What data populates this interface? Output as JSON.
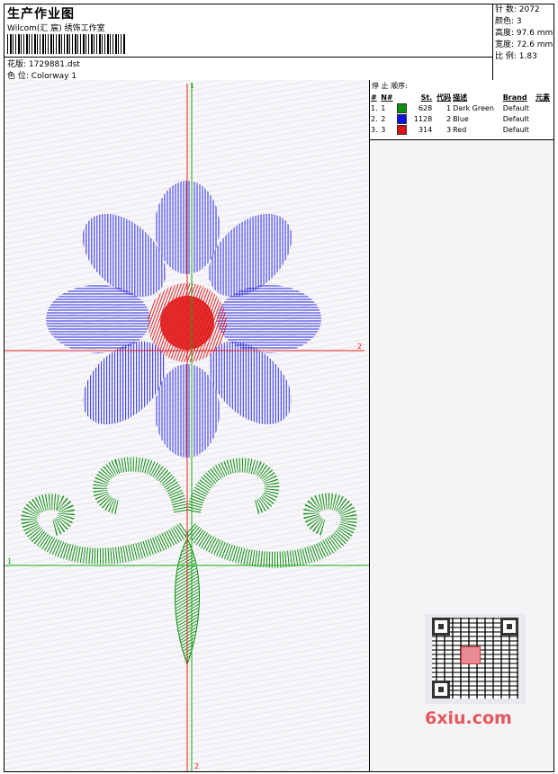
{
  "header": {
    "title": "生产作业图",
    "studio": "Wilcom(汇 宸) 绣饰工作室",
    "file_label": "花版:",
    "file_name": "1729881.dst",
    "color_label": "色 位:",
    "colorway": "Colorway 1"
  },
  "stats": {
    "stitches": "针 数: 2072",
    "colors": "颜色: 3",
    "height": "高度: 97.6 mm",
    "width": "宽度: 72.6 mm",
    "ratio": "比 例: 1.83"
  },
  "stop_sequence": {
    "title": "停 止 顺序:",
    "columns": [
      "#",
      "N#",
      "St.",
      "代码",
      "描述",
      "Brand",
      "元素"
    ],
    "rows": [
      {
        "idx": "1.",
        "n": "1",
        "color": "#109010",
        "st": "628",
        "code": "1",
        "desc": "Dark Green",
        "brand": "Default",
        "element": ""
      },
      {
        "idx": "2.",
        "n": "2",
        "color": "#1010e0",
        "st": "1128",
        "code": "2",
        "desc": "Blue",
        "brand": "Default",
        "element": ""
      },
      {
        "idx": "3.",
        "n": "3",
        "color": "#e01010",
        "st": "314",
        "code": "3",
        "desc": "Red",
        "brand": "Default",
        "element": ""
      }
    ]
  },
  "axes": {
    "top": "1",
    "bottom": "2",
    "right": "2",
    "left": "1"
  },
  "watermark": "6xiu.com",
  "colors": {
    "green": "#109010",
    "blue": "#1010e0",
    "red": "#e01010",
    "axis_red": "#e82020",
    "axis_green": "#10b010"
  }
}
